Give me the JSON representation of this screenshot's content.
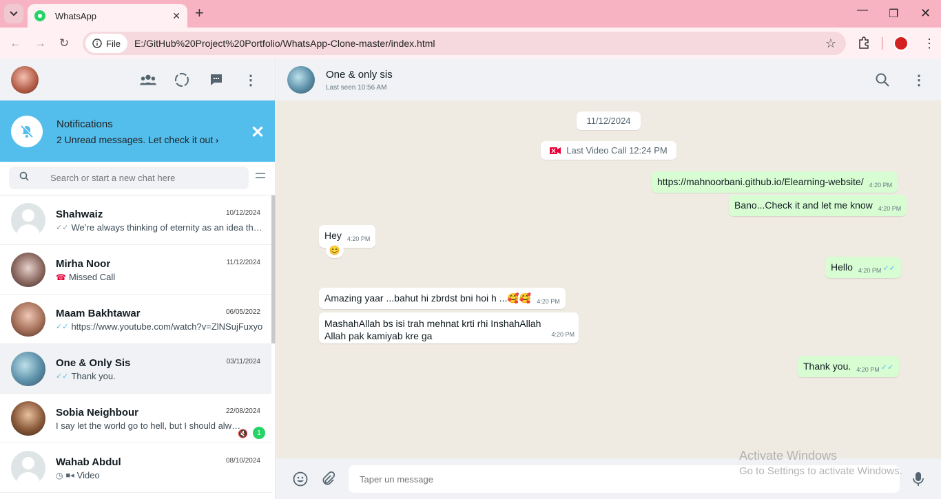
{
  "browser": {
    "tab_title": "WhatsApp",
    "file_chip": "File",
    "url": "E:/GitHub%20Project%20Portfolio/WhatsApp-Clone-master/index.html"
  },
  "sidebar": {
    "notification": {
      "title": "Notifications",
      "subtitle": "2 Unread messages. Let check it out"
    },
    "search_placeholder": "Search or start a new chat here",
    "chats": [
      {
        "name": "Shahwaiz",
        "date": "10/12/2024",
        "preview": "We’re always thinking of eternity as an idea that...",
        "status": "read-grey"
      },
      {
        "name": "Mirha Noor",
        "date": "11/12/2024",
        "preview": "Missed Call",
        "status": "missed-call"
      },
      {
        "name": "Maam Bakhtawar",
        "date": "06/05/2022",
        "preview": "https://www.youtube.com/watch?v=ZlNSujFuxyo",
        "status": "read-blue"
      },
      {
        "name": "One & Only Sis",
        "date": "03/11/2024",
        "preview": "Thank you.",
        "status": "read-blue"
      },
      {
        "name": "Sobia Neighbour",
        "date": "22/08/2024",
        "preview": "I say let the world go to hell, but I should always...",
        "unread": "1",
        "status": "muted"
      },
      {
        "name": "Wahab Abdul",
        "date": "08/10/2024",
        "preview": "Video",
        "status": "video"
      }
    ]
  },
  "conversation": {
    "name": "One & only sis",
    "last_seen": "Last seen 10:56 AM",
    "date_divider": "11/12/2024",
    "call_notice": "Last Video Call 12:24 PM",
    "messages": [
      {
        "dir": "out",
        "text": "https://mahnoorbani.github.io/Elearning-website/",
        "time": "4:20 PM"
      },
      {
        "dir": "out",
        "text": "Bano...Check it and let me know",
        "time": "4:20 PM"
      },
      {
        "dir": "in",
        "text": "Hey",
        "time": "4:20 PM"
      },
      {
        "dir": "out",
        "text": "Hello",
        "time": "4:20 PM"
      },
      {
        "dir": "in",
        "text": "Amazing yaar ...bahut hi zbrdst bni hoi h ...🥰🥰",
        "time": "4:20 PM"
      },
      {
        "dir": "in",
        "text": "MashahAllah bs isi trah mehnat krti rhi InshahAllah",
        "text2": "Allah pak kamiyab kre ga",
        "time": "4:20 PM"
      },
      {
        "dir": "out",
        "text": "Thank you.",
        "time": "4:20 PM"
      }
    ],
    "reaction": "😊",
    "composer_placeholder": "Taper un message"
  },
  "watermark": {
    "line1": "Activate Windows",
    "line2": "Go to Settings to activate Windows."
  },
  "colors": {
    "accent": "#25d366",
    "notif_bg": "#53bdeb",
    "out_bubble": "#d9fdd3",
    "tick_blue": "#53bdeb",
    "chrome": "#f7b3c2"
  }
}
